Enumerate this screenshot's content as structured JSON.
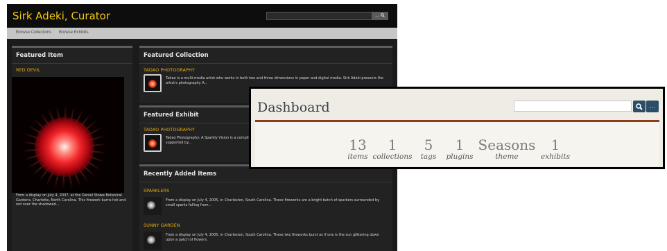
{
  "site": {
    "title": "Sirk Adeki, Curator",
    "search_button": "...",
    "nav": [
      "Browse Collections",
      "Browse Exhibits"
    ]
  },
  "featured_item": {
    "heading": "Featured Item",
    "item_title": "RED DEVIL",
    "description": "From a display on July 4, 2007, at the Daniel Stowe Botanical Gardens, Charlotte, North Carolina. This firework burns hot and red over the shadowed..."
  },
  "featured_collection": {
    "heading": "Featured Collection",
    "item_title": "TADAO PHOTOGRAPHY",
    "description": "Tadao is a multi-media artist who works in both two and three dimensions in paper and digital media. Sirk Adeki presents the artist's photography A..."
  },
  "featured_exhibit": {
    "heading": "Featured Exhibit",
    "item_title": "TADAO PHOTOGRAPHY",
    "description": "Tadao Photography: A Sparkly Vision is a complia... supported by..."
  },
  "recent_items": {
    "heading": "Recently Added Items",
    "items": [
      {
        "title": "SPARKLERS",
        "description": "From a display on July 4, 2005, in Charleston, South Carolina. These fireworks are a bright batch of sparkers surrounded by small sparks falling from..."
      },
      {
        "title": "SUNNY GARDEN",
        "description": "From a display on July 4, 2005, in Charleston, South Carolina. These two fireworks burst as if one is the sun glittering down upon a patch of flowers."
      }
    ]
  },
  "dashboard": {
    "title": "Dashboard",
    "search_placeholder": "",
    "stats": [
      {
        "value": "13",
        "label": "items"
      },
      {
        "value": "1",
        "label": "collections"
      },
      {
        "value": "5",
        "label": "tags"
      },
      {
        "value": "1",
        "label": "plugins"
      },
      {
        "value": "Seasons",
        "label": "theme"
      },
      {
        "value": "1",
        "label": "exhibits"
      }
    ]
  },
  "icons": {
    "search": "search-icon",
    "more": "ellipsis-icon"
  },
  "colors": {
    "site_title": "#f2c80f",
    "link": "#e2ab12",
    "dashboard_rule": "#8e3b1b",
    "dashboard_button": "#2d4d67"
  }
}
